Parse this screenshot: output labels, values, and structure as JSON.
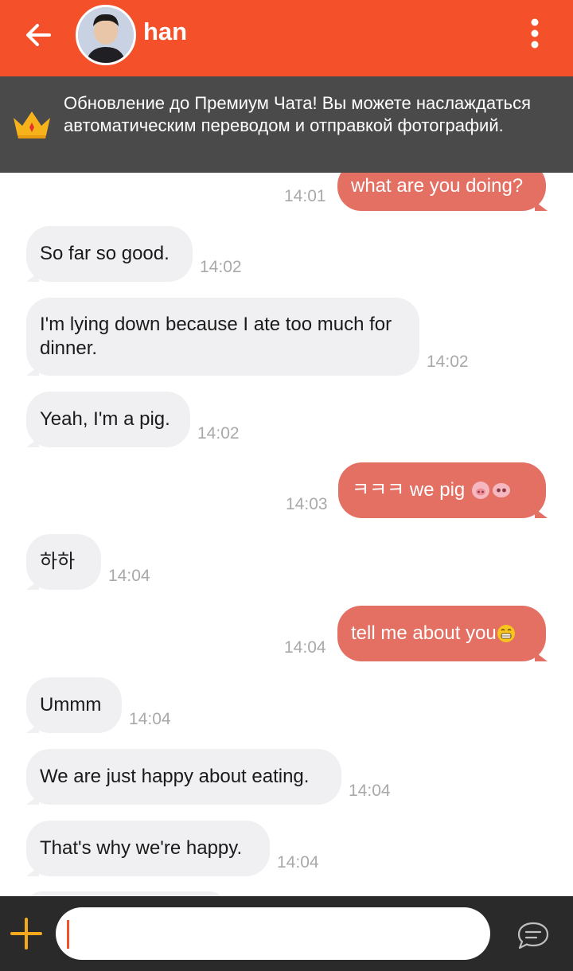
{
  "header": {
    "contact_name": "han",
    "back_icon": "arrow-left-icon",
    "menu_icon": "more-vertical-icon",
    "color": "#f4512a"
  },
  "banner": {
    "text": "Обновление до Премиум Чата! Вы можете наслаждаться автоматическим переводом и отправкой фотографий.",
    "icon": "crown-icon"
  },
  "messages": [
    {
      "side": "out",
      "text": "what are you doing?",
      "time": "14:01"
    },
    {
      "side": "in",
      "text": "So far so good.",
      "time": "14:02"
    },
    {
      "side": "in",
      "text": "I'm lying down because I ate too much for dinner.",
      "time": "14:02"
    },
    {
      "side": "in",
      "text": "Yeah, I'm a pig.",
      "time": "14:02"
    },
    {
      "side": "out",
      "text": "ㅋㅋㅋ we pig",
      "emoji": "pig-faces",
      "time": "14:03"
    },
    {
      "side": "in",
      "text": "하하",
      "time": "14:04"
    },
    {
      "side": "out",
      "text": "tell me about you",
      "emoji": "grin",
      "time": "14:04"
    },
    {
      "side": "in",
      "text": "Ummm",
      "time": "14:04"
    },
    {
      "side": "in",
      "text": "We are just happy about eating.",
      "time": "14:04"
    },
    {
      "side": "in",
      "text": "That's why we're happy.",
      "time": "14:04"
    }
  ],
  "input_bar": {
    "placeholder": "",
    "add_icon": "plus-icon",
    "send_icon": "chat-bubble-icon"
  },
  "colors": {
    "incoming_bubble": "#f0eff1",
    "outgoing_bubble": "#e46f63",
    "timestamp": "#a9a9a9",
    "banner_bg": "#4a4a4a"
  }
}
